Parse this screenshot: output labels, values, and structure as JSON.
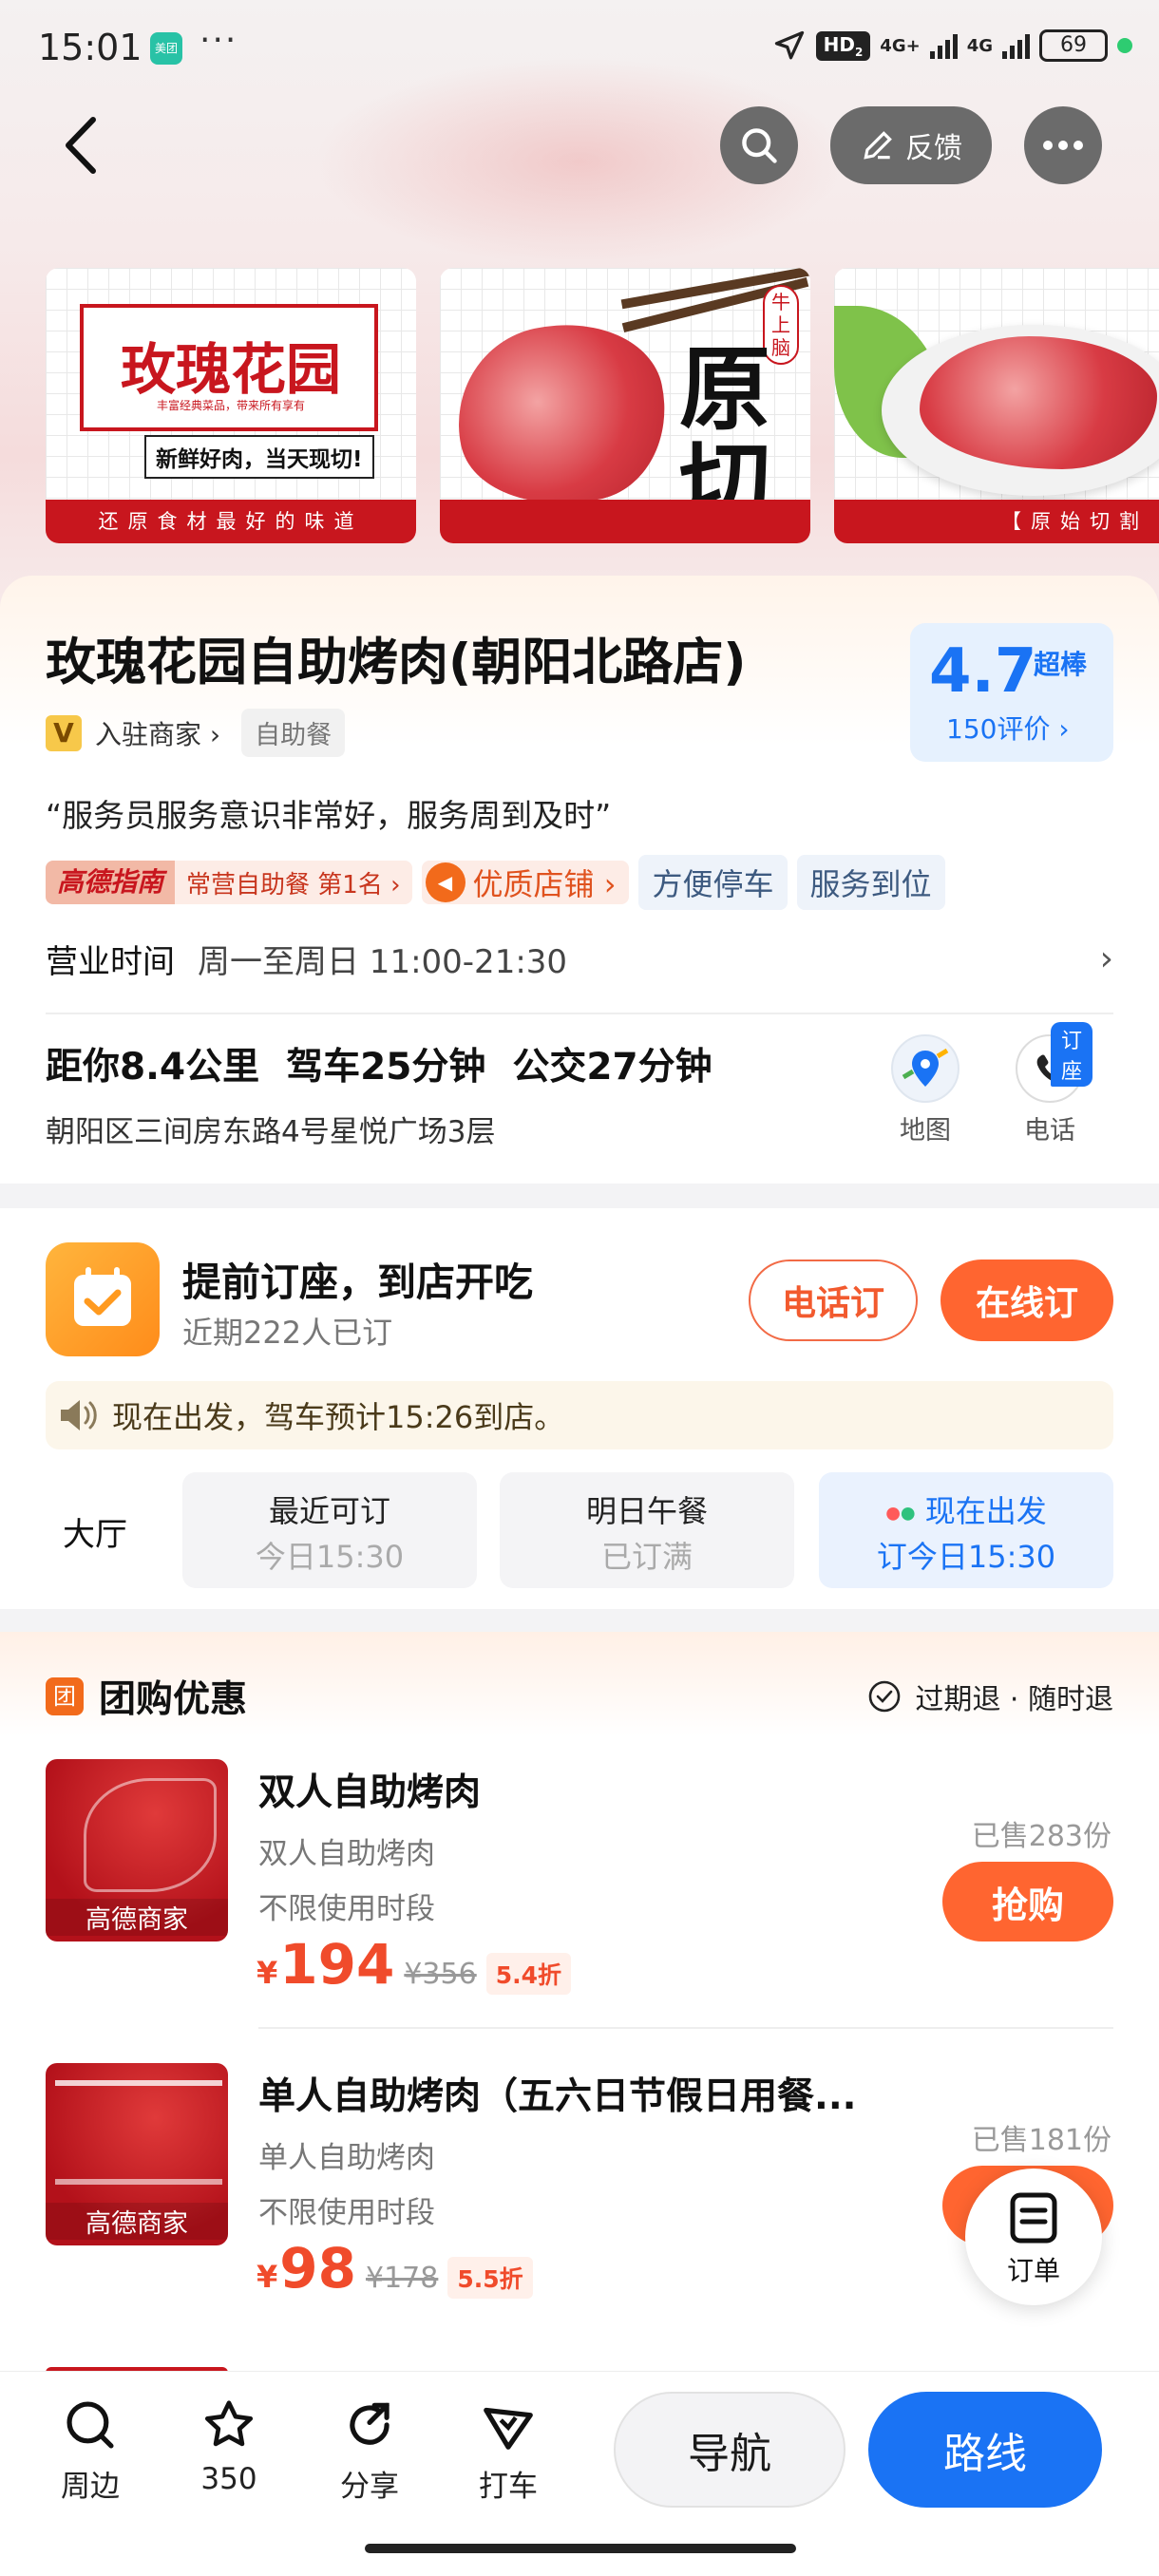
{
  "status_bar": {
    "time": "15:01",
    "app_badge": "美团",
    "more": "···",
    "hd": "HD",
    "hd_sub": "2",
    "sig1": "4G+",
    "sig2": "4G",
    "battery": "69"
  },
  "header": {
    "feedback_label": "反馈"
  },
  "banners": [
    {
      "title": "玫瑰花园",
      "small": "丰富经典菜品，带来所有享有",
      "slogan": "新鲜好肉，当天现切!",
      "footer": "还原食材最好的味道"
    },
    {
      "badge": "牛上脑",
      "big1": "原",
      "big2": "切"
    },
    {
      "footer": "【原始切割"
    }
  ],
  "store": {
    "name": "玫瑰花园自助烤肉(朝阳北路店)",
    "merchant_badge": "V",
    "merchant_label": "入驻商家",
    "category": "自助餐",
    "rating": "4.7",
    "rating_word": "超棒",
    "reviews": "150评价",
    "quote": "“服务员服务意识非常好，服务周到及时”",
    "guide_logo": "高德指南",
    "guide_rank": "常营自助餐 第1名",
    "quality_label": "优质店铺",
    "tags": [
      "方便停车",
      "服务到位"
    ],
    "hours_label": "营业时间",
    "hours_value": "周一至周日 11:00-21:30",
    "distance": "距你8.4公里",
    "drive": "驾车25分钟",
    "bus": "公交27分钟",
    "address": "朝阳区三间房东路4号星悦广场3层",
    "map_label": "地图",
    "phone_label": "电话",
    "phone_badge": "订座"
  },
  "booking": {
    "title": "提前订座，到店开吃",
    "subtitle": "近期222人已订",
    "phone_btn": "电话订",
    "online_btn": "在线订",
    "notice": "现在出发，驾车预计15:26到店。",
    "area": "大厅",
    "slots": [
      {
        "line1": "最近可订",
        "line2": "今日15:30"
      },
      {
        "line1": "明日午餐",
        "line2": "已订满"
      },
      {
        "line1": "现在出发",
        "line2": "订今日15:30"
      }
    ]
  },
  "deals": {
    "section_icon": "团",
    "section_title": "团购优惠",
    "policy": "过期退 · 随时退",
    "items": [
      {
        "title": "双人自助烤肉",
        "sub": "双人自助烤肉",
        "time": "不限使用时段",
        "currency": "¥",
        "price": "194",
        "original": "¥356",
        "discount": "5.4折",
        "sold": "已售283份",
        "buy": "抢购",
        "thumb_label": "高德商家"
      },
      {
        "title": "单人自助烤肉（五六日节假日用餐...",
        "sub": "单人自助烤肉",
        "time": "不限使用时段",
        "currency": "¥",
        "price": "98",
        "original": "¥178",
        "discount": "5.5折",
        "sold": "已售181份",
        "buy": "抢购",
        "thumb_label": "高德商家"
      }
    ]
  },
  "fab": {
    "label": "订单"
  },
  "bottom_bar": {
    "nearby": "周边",
    "favorites": "350",
    "share": "分享",
    "taxi": "打车",
    "navigate": "导航",
    "route": "路线"
  }
}
